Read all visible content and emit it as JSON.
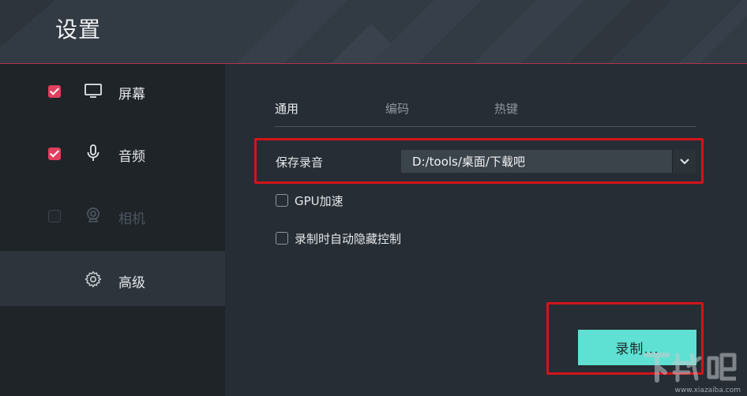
{
  "header": {
    "title": "设置"
  },
  "sidebar": {
    "items": [
      {
        "label": "屏幕",
        "checked": true,
        "enabled": true,
        "icon": "monitor-icon"
      },
      {
        "label": "音频",
        "checked": true,
        "enabled": true,
        "icon": "microphone-icon"
      },
      {
        "label": "相机",
        "checked": false,
        "enabled": false,
        "icon": "webcam-icon"
      },
      {
        "label": "高级",
        "selected": true,
        "icon": "gear-icon"
      }
    ]
  },
  "tabs": [
    {
      "label": "通用",
      "active": true
    },
    {
      "label": "编码",
      "active": false
    },
    {
      "label": "热键",
      "active": false
    }
  ],
  "general": {
    "save_label": "保存录音",
    "save_path": "D:/tools/桌面/下载吧",
    "gpu_label": "GPU加速",
    "gpu_checked": false,
    "hide_label": "录制时自动隐藏控制",
    "hide_checked": false
  },
  "record_button": {
    "label": "录制..."
  },
  "colors": {
    "accent": "#e0405e",
    "button": "#5ee0d2",
    "highlight_box": "#d2141c"
  },
  "watermark": {
    "text": "www.xiazaiba.com"
  }
}
